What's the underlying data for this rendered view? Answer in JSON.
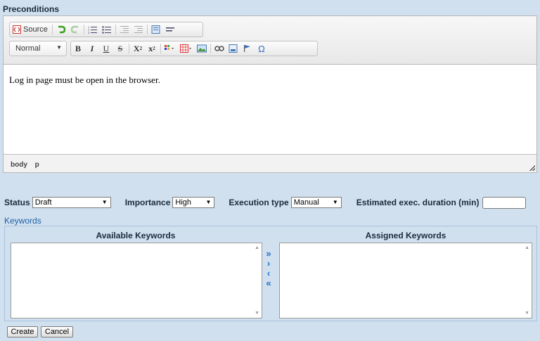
{
  "preconditions": {
    "title": "Preconditions",
    "content": "Log in page must be open in the browser.",
    "path": [
      "body",
      "p"
    ]
  },
  "toolbar": {
    "source_label": "Source",
    "format_value": "Normal",
    "bold": "B",
    "italic": "I",
    "underline": "U",
    "strike": "S",
    "subscript": "X",
    "subscript_mark": "2",
    "superscript": "x",
    "superscript_mark": "2",
    "special_char": "Ω"
  },
  "fields": {
    "status_label": "Status",
    "status_value": "Draft",
    "importance_label": "Importance",
    "importance_value": "High",
    "execution_label": "Execution type",
    "execution_value": "Manual",
    "duration_label": "Estimated exec. duration (min)",
    "duration_value": ""
  },
  "keywords": {
    "title": "Keywords",
    "available_label": "Available Keywords",
    "assigned_label": "Assigned Keywords",
    "move_all_right": "»",
    "move_right": "›",
    "move_left": "‹",
    "move_all_left": "«"
  },
  "actions": {
    "create_label": "Create",
    "cancel_label": "Cancel"
  },
  "colors": {
    "background": "#d1e0ee",
    "keywords_title": "#1f5ea8",
    "arrow_blue": "#1c6fd0"
  }
}
